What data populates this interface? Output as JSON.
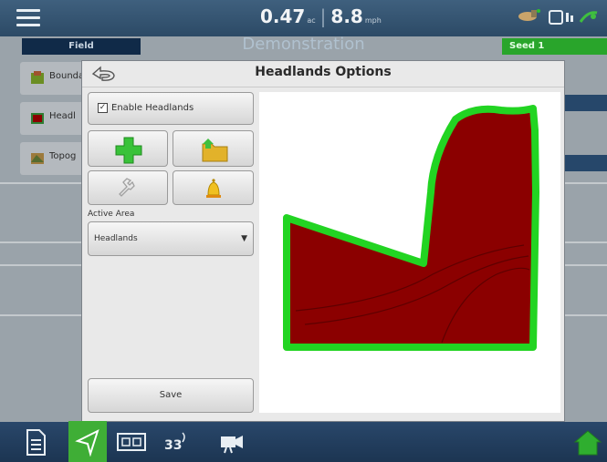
{
  "topbar": {
    "area_value": "0.47",
    "area_unit": "ac",
    "speed_value": "8.8",
    "speed_unit": "mph"
  },
  "header": {
    "field_tab": "Field",
    "field_name": "Demonstration",
    "seed_tab": "Seed 1"
  },
  "background_panel": {
    "items": [
      "Bounda",
      "Headl",
      "Topog"
    ]
  },
  "modal": {
    "title": "Headlands Options",
    "enable_label": "Enable Headlands",
    "enable_checked_glyph": "✓",
    "active_area_label": "Active Area",
    "active_area_value": "Headlands",
    "save_label": "Save"
  },
  "icons": {
    "menu": "hamburger-menu-icon",
    "back": "back-arrow-icon",
    "add": "plus-icon",
    "load": "folder-icon",
    "edit": "wrench-icon",
    "alert": "bell-icon",
    "gps": "satellite-icon",
    "document": "document-icon",
    "navigate": "navigation-arrow-icon",
    "split": "split-screen-icon",
    "yield": "yield-icon",
    "camera": "video-camera-icon",
    "home": "home-icon"
  },
  "colors": {
    "field_fill": "#8b0000",
    "headland_stroke": "#22d422",
    "active_nav": "#3fae36",
    "seed_tab": "#29a52b"
  }
}
